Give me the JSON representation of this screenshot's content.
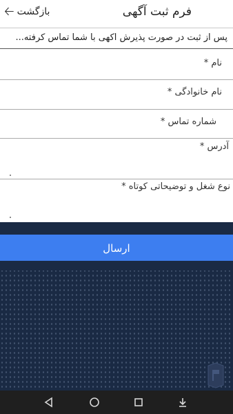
{
  "header": {
    "title": "فرم ثبت آگهی",
    "back_label": "بازگشت"
  },
  "notice": "پس از ثبت در صورت پذیرش اکهی با شما تماس کرفته...",
  "form": {
    "fields": [
      {
        "label": "نام *"
      },
      {
        "label": "نام خانوادگی *"
      },
      {
        "label": "شماره تماس *"
      },
      {
        "label": "آدرس *"
      },
      {
        "label": "نوع شغل و توضیحاتی کوتاه *"
      }
    ],
    "submit_label": "ارسال"
  },
  "colors": {
    "accent": "#3d7ef0",
    "background_panel": "#1a2a44",
    "navbar": "#1f1f1f"
  },
  "navbar": {
    "icons": [
      "back-triangle-icon",
      "home-circle-icon",
      "recents-square-icon",
      "download-icon"
    ]
  }
}
